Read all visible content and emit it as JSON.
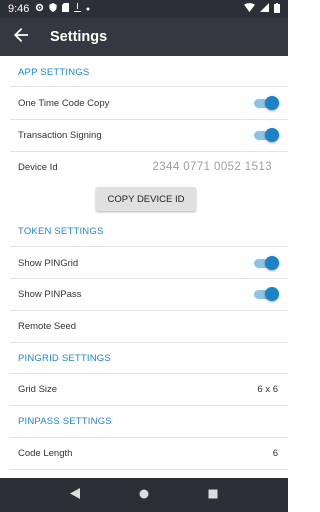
{
  "status_bar": {
    "time": "9:46",
    "left_icons": [
      "gear-icon",
      "shield-icon",
      "sd-card-icon",
      "download-icon",
      "dot-icon"
    ],
    "right_icons": [
      "wifi-icon",
      "signal-icon",
      "battery-icon"
    ]
  },
  "app_bar": {
    "title": "Settings",
    "back_icon": "arrow-back-icon"
  },
  "app_settings": {
    "header": "APP SETTINGS",
    "one_time_code_copy": {
      "label": "One Time Code Copy",
      "on": true
    },
    "transaction_signing": {
      "label": "Transaction Signing",
      "on": true
    },
    "device_id": {
      "label": "Device Id",
      "value": "2344 0771 0052 1513"
    },
    "copy_button": "COPY DEVICE ID"
  },
  "token_settings": {
    "header": "TOKEN SETTINGS",
    "show_pingrid": {
      "label": "Show PINGrid",
      "on": true
    },
    "show_pinpass": {
      "label": "Show PINPass",
      "on": true
    },
    "remote_seed": {
      "label": "Remote Seed"
    }
  },
  "pingrid_settings": {
    "header": "PINGRID SETTINGS",
    "grid_size": {
      "label": "Grid Size",
      "value": "6 x 6"
    }
  },
  "pinpass_settings": {
    "header": "PINPASS SETTINGS",
    "code_length": {
      "label": "Code Length",
      "value": "6"
    }
  },
  "colors": {
    "accent": "#1b83c6",
    "app_bar": "#353840",
    "status_bar": "#2c2f36"
  },
  "nav_bar": {
    "buttons": [
      "back-triangle-icon",
      "home-circle-icon",
      "recents-square-icon"
    ]
  }
}
